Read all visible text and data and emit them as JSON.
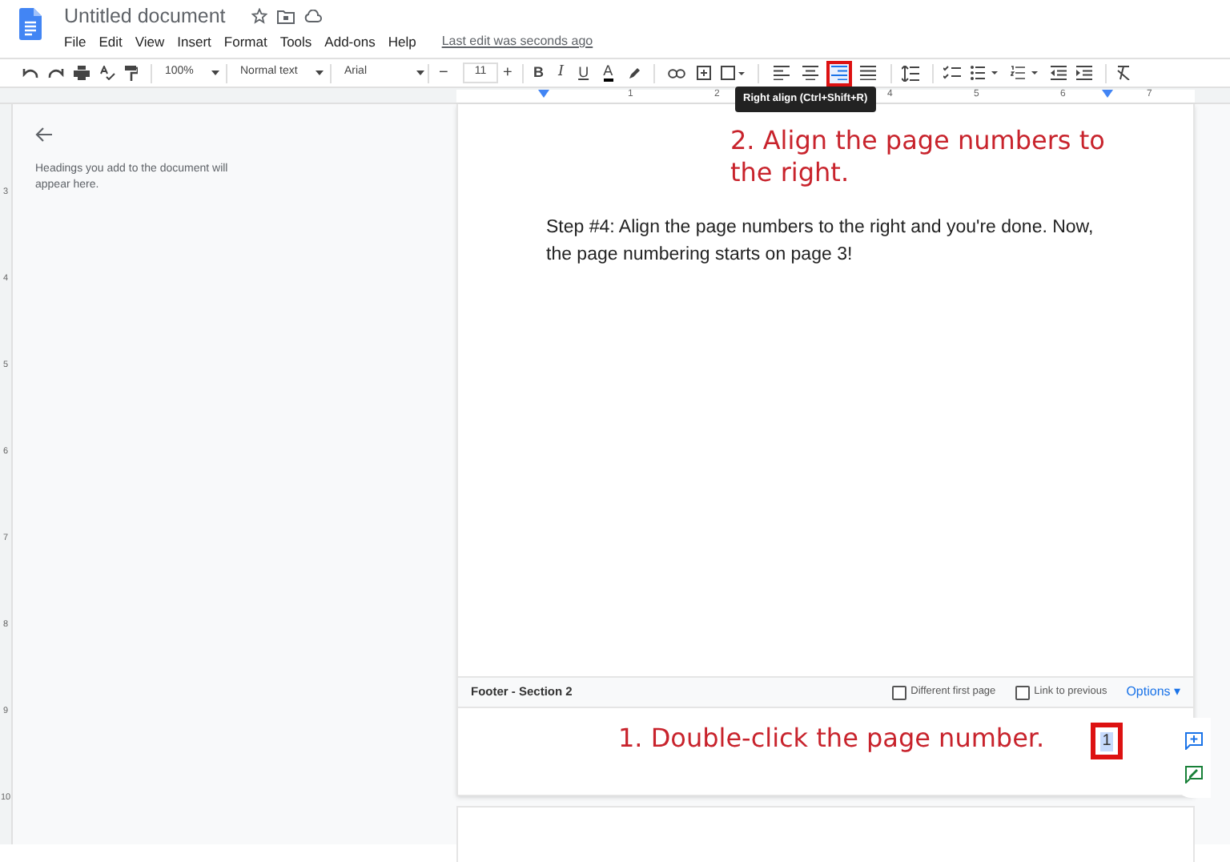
{
  "document": {
    "title": "Untitled document",
    "last_edit": "Last edit was seconds ago"
  },
  "menu": [
    "File",
    "Edit",
    "View",
    "Insert",
    "Format",
    "Tools",
    "Add-ons",
    "Help"
  ],
  "toolbar": {
    "zoom": "100%",
    "style": "Normal text",
    "font": "Arial",
    "font_size": "11",
    "minus": "−",
    "plus": "+",
    "format_buttons": [
      "B",
      "I",
      "U",
      "A"
    ],
    "align_buttons": [
      {
        "selected": false
      },
      {
        "selected": false
      },
      {
        "selected": true
      },
      {
        "selected": false
      }
    ],
    "tooltip": "Right align (Ctrl+Shift+R)"
  },
  "ruler": {
    "horizontal": [
      "1",
      "2",
      "4",
      "5",
      "6",
      "7"
    ],
    "vertical": [
      "3",
      "4",
      "5",
      "6",
      "7",
      "8",
      "9",
      "10"
    ]
  },
  "outline": {
    "hint": "Headings you add to the document will appear here."
  },
  "page": {
    "annotation_top": "2. Align the page numbers to the right.",
    "body": "Step #4: Align the page numbers to the right and you're done. Now, the page numbering starts on page 3!"
  },
  "footer": {
    "label": "Footer - Section 2",
    "options": [
      {
        "label": "Different first page",
        "checked": false
      },
      {
        "label": "Link to previous",
        "checked": false
      }
    ],
    "menu": "Options ▾",
    "annotation": "1. Double-click the page number.",
    "page_number": "1"
  }
}
